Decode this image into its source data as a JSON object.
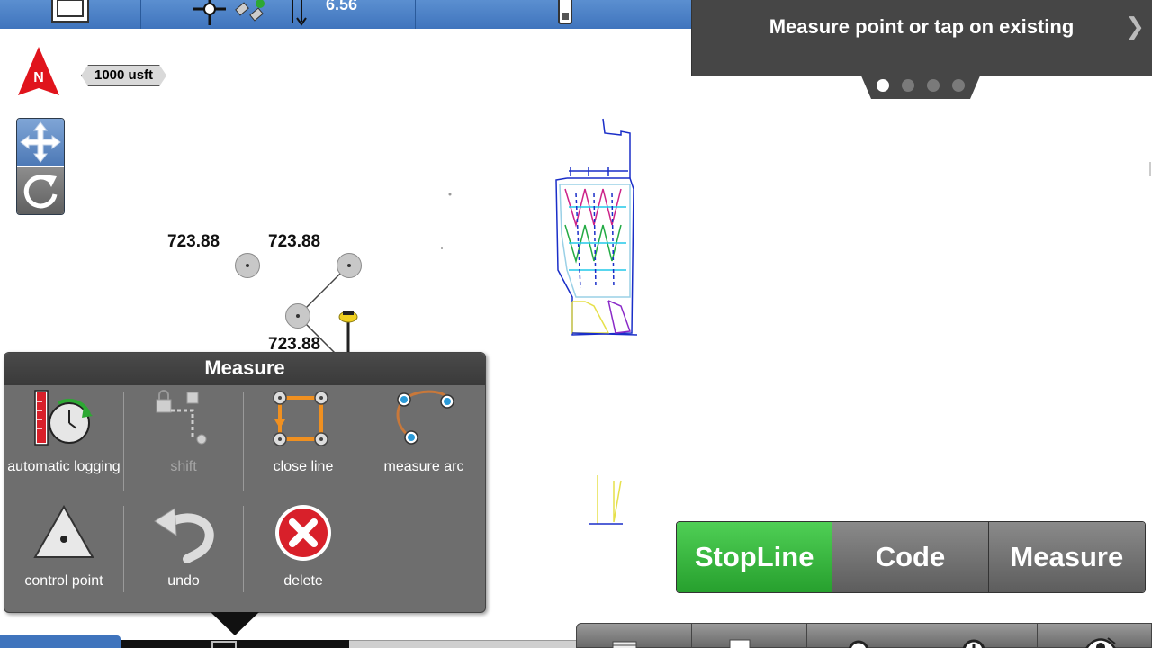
{
  "status_bar": {
    "depth_value": "6.56",
    "icons": [
      "map-view-icon",
      "gnss-receiver-icon",
      "satellite-icon",
      "height-arrow-icon",
      "controller-device-icon"
    ]
  },
  "instruction": {
    "text": "Measure point or tap on existing",
    "page_count": 4,
    "active_page": 1
  },
  "map": {
    "north_label": "N",
    "scale_label": "1000 usft",
    "points": [
      {
        "elevation": "723.88"
      },
      {
        "elevation": "723.88"
      },
      {
        "elevation": "723.88"
      }
    ]
  },
  "measure_panel": {
    "title": "Measure",
    "tools": [
      {
        "label": "automatic logging",
        "enabled": true
      },
      {
        "label": "shift",
        "enabled": false
      },
      {
        "label": "close line",
        "enabled": true
      },
      {
        "label": "measure arc",
        "enabled": true
      },
      {
        "label": "control point",
        "enabled": true
      },
      {
        "label": "undo",
        "enabled": true
      },
      {
        "label": "delete",
        "enabled": true
      }
    ]
  },
  "actions": {
    "stopline_label": "StopLine",
    "code_label": "Code",
    "measure_label": "Measure"
  },
  "colors": {
    "accent_blue": "#3f74bd",
    "panel_gray": "#6e6e6e",
    "green_button": "#27a02e",
    "north_red": "#e0141c",
    "delete_red": "#d8202a"
  }
}
